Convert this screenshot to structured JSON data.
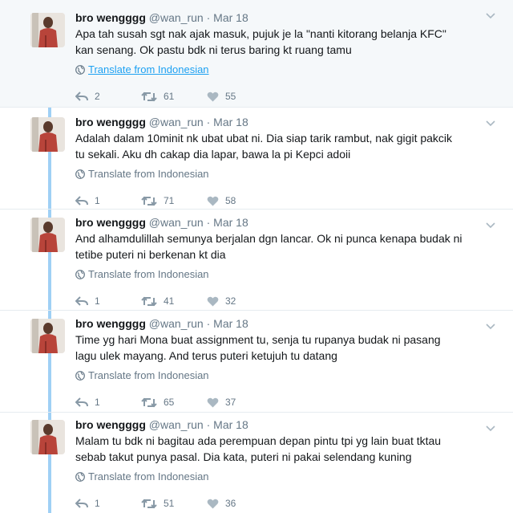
{
  "tweets": [
    {
      "name": "bro wengggg",
      "handle": "@wan_run",
      "dot": "·",
      "date": "Mar 18",
      "lines": [
        "Apa tah susah sgt nak ajak masuk, pujuk je la \"nanti kitorang belanja KFC\"",
        "kan senang. Ok pastu bdk ni terus baring kt ruang tamu"
      ],
      "translate": "Translate from Indonesian",
      "replies": "2",
      "retweets": "61",
      "likes": "55"
    },
    {
      "name": "bro wengggg",
      "handle": "@wan_run",
      "dot": "·",
      "date": "Mar 18",
      "lines": [
        "Adalah dalam 10minit nk ubat ubat ni. Dia siap tarik rambut, nak gigit pakcik",
        "tu sekali. Aku dh cakap dia lapar, bawa la pi Kepci adoii"
      ],
      "translate": "Translate from Indonesian",
      "replies": "1",
      "retweets": "71",
      "likes": "58"
    },
    {
      "name": "bro wengggg",
      "handle": "@wan_run",
      "dot": "·",
      "date": "Mar 18",
      "lines": [
        "And alhamdulillah semunya berjalan dgn lancar. Ok ni punca kenapa budak ni",
        "tetibe puteri ni berkenan kt dia"
      ],
      "translate": "Translate from Indonesian",
      "replies": "1",
      "retweets": "41",
      "likes": "32"
    },
    {
      "name": "bro wengggg",
      "handle": "@wan_run",
      "dot": "·",
      "date": "Mar 18",
      "lines": [
        "Time yg hari Mona buat assignment tu, senja tu rupanya budak ni pasang",
        "lagu ulek mayang. And terus puteri ketujuh tu datang"
      ],
      "translate": "Translate from Indonesian",
      "replies": "1",
      "retweets": "65",
      "likes": "37"
    },
    {
      "name": "bro wengggg",
      "handle": "@wan_run",
      "dot": "·",
      "date": "Mar 18",
      "lines": [
        "Malam tu bdk ni bagitau ada perempuan depan pintu tpi yg lain buat tktau",
        "sebab takut punya pasal. Dia kata, puteri ni pakai selendang kuning"
      ],
      "translate": "Translate from Indonesian",
      "replies": "1",
      "retweets": "51",
      "likes": "36"
    }
  ],
  "icons": {
    "reply": "reply-icon",
    "retweet": "retweet-icon",
    "like": "heart-icon",
    "globe": "globe-icon",
    "caret": "chevron-down-icon"
  },
  "colors": {
    "thread_line": "#9fd0f5",
    "link": "#1da1f2",
    "muted": "#657786",
    "highlight_bg": "#f5f8fa"
  }
}
